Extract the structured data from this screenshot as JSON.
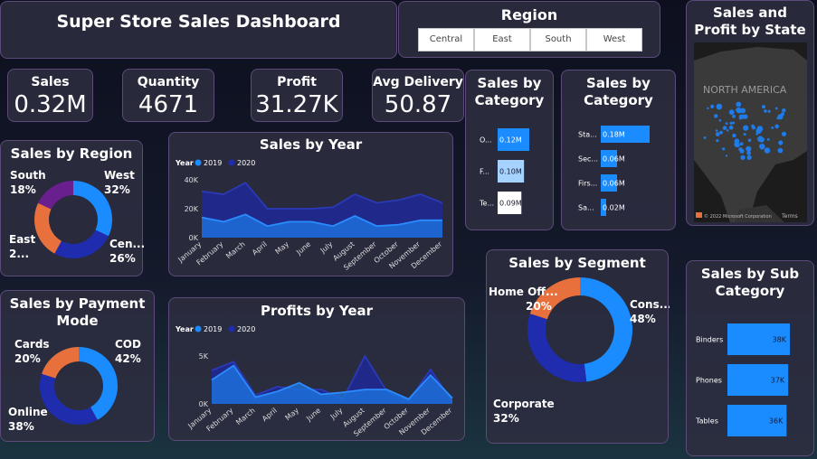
{
  "title": "Super Store Sales Dashboard",
  "region_filter": {
    "title": "Region",
    "options": [
      "Central",
      "East",
      "South",
      "West"
    ]
  },
  "kpis": {
    "sales": {
      "label": "Sales",
      "value": "0.32M"
    },
    "quantity": {
      "label": "Quantity",
      "value": "4671"
    },
    "profit": {
      "label": "Profit",
      "value": "31.27K"
    },
    "delivery": {
      "label": "Avg Delivery",
      "value": "50.87"
    }
  },
  "colors": {
    "blue": "#1a8cff",
    "navy": "#1f2cae",
    "orange": "#e8703c",
    "purple": "#6a1f8f",
    "lightblue": "#a6d2ff"
  },
  "map": {
    "title": "Sales and Profit by State",
    "label": "NORTH AMERICA",
    "copyright": "© 2022 Microsoft Corporation",
    "terms": "Terms",
    "brand": "Microsoft"
  },
  "charts": {
    "sales_by_region": {
      "type": "pie",
      "title": "Sales by Region",
      "slices": [
        {
          "name": "West",
          "pct": 32,
          "label": "32%"
        },
        {
          "name": "Cen...",
          "pct": 26,
          "label": "26%"
        },
        {
          "name": "East",
          "pct": 24,
          "label": "2..."
        },
        {
          "name": "South",
          "pct": 18,
          "label": "18%"
        }
      ]
    },
    "sales_by_year": {
      "type": "area",
      "title": "Sales by Year",
      "legend_title": "Year",
      "categories": [
        "January",
        "February",
        "March",
        "April",
        "May",
        "June",
        "July",
        "August",
        "September",
        "October",
        "November",
        "December"
      ],
      "series": [
        {
          "name": "2019",
          "values": [
            14000,
            11000,
            16000,
            8000,
            11000,
            11000,
            8000,
            15000,
            8000,
            9000,
            12000,
            12000
          ]
        },
        {
          "name": "2020",
          "values": [
            32000,
            30000,
            38000,
            20000,
            20000,
            20000,
            21000,
            30000,
            24000,
            26000,
            30000,
            24000
          ]
        }
      ],
      "yticks": [
        "40K",
        "20K",
        "0K"
      ],
      "ylim": [
        0,
        40000
      ]
    },
    "profits_by_year": {
      "type": "area",
      "title": "Profits by Year",
      "legend_title": "Year",
      "categories": [
        "January",
        "February",
        "March",
        "April",
        "May",
        "June",
        "July",
        "August",
        "September",
        "October",
        "November",
        "December"
      ],
      "series": [
        {
          "name": "2019",
          "values": [
            2500,
            4000,
            700,
            1300,
            2200,
            1000,
            1200,
            1500,
            1500,
            500,
            3000,
            600
          ]
        },
        {
          "name": "2020",
          "values": [
            3500,
            4400,
            900,
            1800,
            1500,
            1500,
            500,
            5000,
            1300,
            300,
            3600,
            200
          ]
        }
      ],
      "yticks": [
        "5K",
        "0K"
      ],
      "ylim": [
        0,
        5000
      ]
    },
    "sales_by_category_1": {
      "type": "bar",
      "title": "Sales by Category",
      "categories": [
        "O...",
        "F...",
        "Te..."
      ],
      "values": [
        0.12,
        0.1,
        0.09
      ],
      "labels": [
        "0.12M",
        "0.10M",
        "0.09M"
      ]
    },
    "sales_by_category_2": {
      "type": "bar",
      "title": "Sales by Category",
      "categories": [
        "Sta...",
        "Sec...",
        "Firs...",
        "Sa..."
      ],
      "values": [
        0.18,
        0.06,
        0.06,
        0.02
      ],
      "labels": [
        "0.18M",
        "0.06M",
        "0.06M",
        "0.02M"
      ]
    },
    "sales_by_payment": {
      "type": "pie",
      "title": "Sales by Payment Mode",
      "slices": [
        {
          "name": "COD",
          "pct": 42,
          "label": "42%"
        },
        {
          "name": "Online",
          "pct": 38,
          "label": "38%"
        },
        {
          "name": "Cards",
          "pct": 20,
          "label": "20%"
        }
      ]
    },
    "sales_by_segment": {
      "type": "pie",
      "title": "Sales by Segment",
      "slices": [
        {
          "name": "Cons...",
          "pct": 48,
          "label": "48%"
        },
        {
          "name": "Corporate",
          "pct": 32,
          "label": "32%"
        },
        {
          "name": "Home Off...",
          "pct": 20,
          "label": "20%"
        }
      ]
    },
    "sales_by_subcategory": {
      "type": "bar",
      "title": "Sales by Sub Category",
      "categories": [
        "Binders",
        "Phones",
        "Tables"
      ],
      "values": [
        38,
        37,
        36
      ],
      "labels": [
        "38K",
        "37K",
        "36K"
      ]
    }
  }
}
